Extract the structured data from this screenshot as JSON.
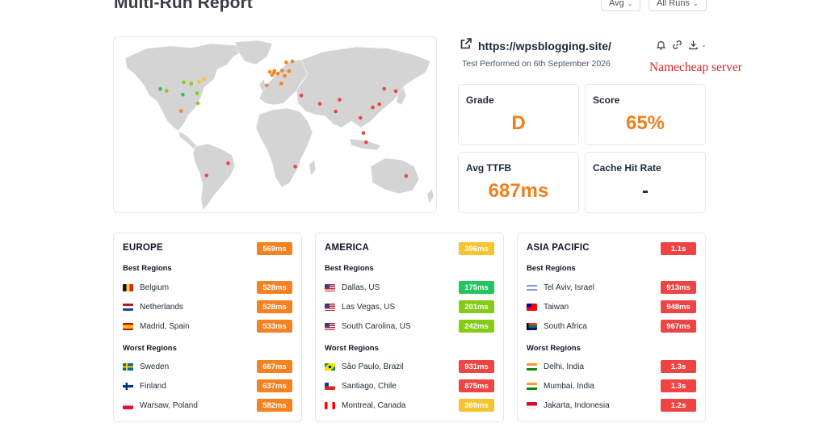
{
  "page": {
    "title": "Multi-Run Report"
  },
  "filters": {
    "metric": "Avg",
    "runs": "All Runs"
  },
  "site": {
    "url": "https://wpsblogging.site/",
    "test_date": "Test Performed on 6th September 2026",
    "annotation": "Namecheap server"
  },
  "stats": {
    "grade": {
      "label": "Grade",
      "value": "D"
    },
    "score": {
      "label": "Score",
      "value": "65%"
    },
    "ttfb": {
      "label": "Avg TTFB",
      "value": "687ms"
    },
    "cache": {
      "label": "Cache Hit Rate",
      "value": "-"
    }
  },
  "colors": {
    "orange": "#f58220",
    "yellow": "#f6c42e",
    "red": "#ef4444",
    "green_bright": "#22c55e",
    "green_light": "#84cc16",
    "map_land": "#d4d4d4"
  },
  "regions": [
    {
      "name": "EUROPE",
      "avg": "569ms",
      "avg_color": "#f58220",
      "best_label": "Best Regions",
      "worst_label": "Worst Regions",
      "best": [
        {
          "flag": "be",
          "name": "Belgium",
          "time": "528ms",
          "color": "#f58220"
        },
        {
          "flag": "nl",
          "name": "Netherlands",
          "time": "528ms",
          "color": "#f58220"
        },
        {
          "flag": "es",
          "name": "Madrid, Spain",
          "time": "533ms",
          "color": "#f58220"
        }
      ],
      "worst": [
        {
          "flag": "se",
          "name": "Sweden",
          "time": "667ms",
          "color": "#f58220"
        },
        {
          "flag": "fi",
          "name": "Finland",
          "time": "637ms",
          "color": "#f58220"
        },
        {
          "flag": "pl",
          "name": "Warsaw, Poland",
          "time": "582ms",
          "color": "#f58220"
        }
      ]
    },
    {
      "name": "AMERICA",
      "avg": "396ms",
      "avg_color": "#f6c42e",
      "best_label": "Best Regions",
      "worst_label": "Worst Regions",
      "best": [
        {
          "flag": "us",
          "name": "Dallas, US",
          "time": "175ms",
          "color": "#22c55e"
        },
        {
          "flag": "us",
          "name": "Las Vegas, US",
          "time": "201ms",
          "color": "#84cc16"
        },
        {
          "flag": "us",
          "name": "South Carolina, US",
          "time": "242ms",
          "color": "#84cc16"
        }
      ],
      "worst": [
        {
          "flag": "br",
          "name": "São Paulo, Brazil",
          "time": "931ms",
          "color": "#ef4444"
        },
        {
          "flag": "cl",
          "name": "Santiago, Chile",
          "time": "875ms",
          "color": "#ef4444"
        },
        {
          "flag": "ca",
          "name": "Montreal, Canada",
          "time": "369ms",
          "color": "#f6c42e"
        }
      ]
    },
    {
      "name": "ASIA PACIFIC",
      "avg": "1.1s",
      "avg_color": "#ef4444",
      "best_label": "Best Regions",
      "worst_label": "Worst Regions",
      "best": [
        {
          "flag": "il",
          "name": "Tel Aviv, Israel",
          "time": "913ms",
          "color": "#ef4444"
        },
        {
          "flag": "tw",
          "name": "Taiwan",
          "time": "948ms",
          "color": "#ef4444"
        },
        {
          "flag": "za",
          "name": "South Africa",
          "time": "967ms",
          "color": "#ef4444"
        }
      ],
      "worst": [
        {
          "flag": "in",
          "name": "Delhi, India",
          "time": "1.3s",
          "color": "#ef4444"
        },
        {
          "flag": "in",
          "name": "Mumbai, India",
          "time": "1.3s",
          "color": "#ef4444"
        },
        {
          "flag": "id",
          "name": "Jakarta, Indonesia",
          "time": "1.2s",
          "color": "#ef4444"
        }
      ]
    }
  ],
  "map_points": [
    {
      "lon": -122,
      "lat": 37.5,
      "color": "#22c55e"
    },
    {
      "lon": -115,
      "lat": 36,
      "color": "#84cc16"
    },
    {
      "lon": -97,
      "lat": 32.8,
      "color": "#22c55e"
    },
    {
      "lon": -96,
      "lat": 43,
      "color": "#84cc16"
    },
    {
      "lon": -81,
      "lat": 34,
      "color": "#84cc16"
    },
    {
      "lon": -79,
      "lat": 43.5,
      "color": "#f6c42e"
    },
    {
      "lon": -73.6,
      "lat": 45.5,
      "color": "#f6c42e"
    },
    {
      "lon": -87.6,
      "lat": 41.9,
      "color": "#84cc16"
    },
    {
      "lon": -80.2,
      "lat": 25.8,
      "color": "#84cc16"
    },
    {
      "lon": -99,
      "lat": 19.4,
      "color": "#f58220"
    },
    {
      "lon": -70.6,
      "lat": -33.4,
      "color": "#ef4444"
    },
    {
      "lon": -46.6,
      "lat": -23.5,
      "color": "#ef4444"
    },
    {
      "lon": 4.4,
      "lat": 50.8,
      "color": "#f58220"
    },
    {
      "lon": 4.9,
      "lat": 52.4,
      "color": "#f58220"
    },
    {
      "lon": -3.7,
      "lat": 40.4,
      "color": "#f58220"
    },
    {
      "lon": 18,
      "lat": 59.3,
      "color": "#f58220"
    },
    {
      "lon": 24.9,
      "lat": 60.2,
      "color": "#f58220"
    },
    {
      "lon": 21,
      "lat": 52.2,
      "color": "#f58220"
    },
    {
      "lon": 2.3,
      "lat": 48.9,
      "color": "#f58220"
    },
    {
      "lon": 13.4,
      "lat": 52.5,
      "color": "#f58220"
    },
    {
      "lon": -0.1,
      "lat": 51.5,
      "color": "#f58220"
    },
    {
      "lon": 8.7,
      "lat": 50.1,
      "color": "#f58220"
    },
    {
      "lon": 12.5,
      "lat": 41.9,
      "color": "#f58220"
    },
    {
      "lon": 16.4,
      "lat": 48.2,
      "color": "#f58220"
    },
    {
      "lon": 34.8,
      "lat": 32.1,
      "color": "#ef4444"
    },
    {
      "lon": 55.3,
      "lat": 25.3,
      "color": "#ef4444"
    },
    {
      "lon": 77.2,
      "lat": 28.6,
      "color": "#ef4444"
    },
    {
      "lon": 72.9,
      "lat": 19.1,
      "color": "#ef4444"
    },
    {
      "lon": 106.8,
      "lat": -6.2,
      "color": "#ef4444"
    },
    {
      "lon": 121.5,
      "lat": 25,
      "color": "#ef4444"
    },
    {
      "lon": 114.2,
      "lat": 22.3,
      "color": "#ef4444"
    },
    {
      "lon": 139.7,
      "lat": 35.7,
      "color": "#ef4444"
    },
    {
      "lon": 103.8,
      "lat": 1.35,
      "color": "#ef4444"
    },
    {
      "lon": 28,
      "lat": -26.2,
      "color": "#ef4444"
    },
    {
      "lon": 151.2,
      "lat": -33.9,
      "color": "#ef4444"
    },
    {
      "lon": 100.5,
      "lat": 13.8,
      "color": "#ef4444"
    },
    {
      "lon": 126.9,
      "lat": 37.6,
      "color": "#ef4444"
    }
  ]
}
